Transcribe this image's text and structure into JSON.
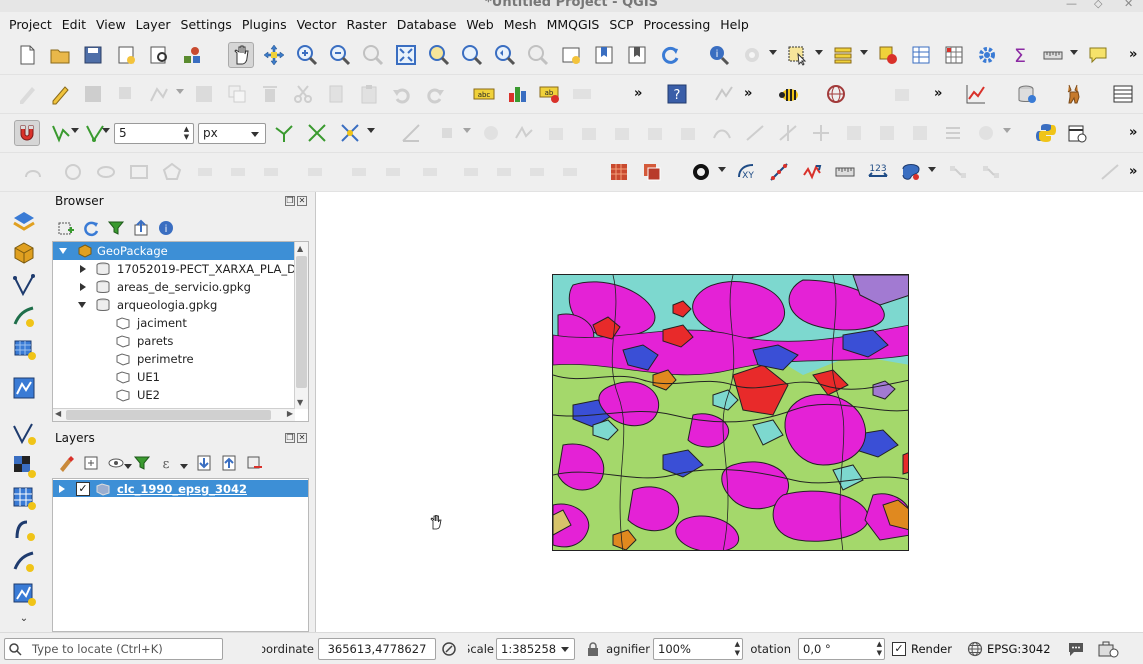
{
  "window": {
    "title": "*Untitled Project - QGIS"
  },
  "menu": [
    "Project",
    "Edit",
    "View",
    "Layer",
    "Settings",
    "Plugins",
    "Vector",
    "Raster",
    "Database",
    "Web",
    "Mesh",
    "MMQGIS",
    "SCP",
    "Processing",
    "Help"
  ],
  "snapping": {
    "tolerance": "5",
    "units": "px"
  },
  "browser": {
    "title": "Browser",
    "items": [
      {
        "label": "GeoPackage",
        "level": 0,
        "expanded": true,
        "selected": true,
        "icon": "geopackage-icon"
      },
      {
        "label": "17052019-PECT_XARXA_PLA_DE",
        "level": 1,
        "expanded": false,
        "icon": "database-icon"
      },
      {
        "label": "areas_de_servicio.gpkg",
        "level": 1,
        "expanded": false,
        "icon": "database-icon"
      },
      {
        "label": "arqueologia.gpkg",
        "level": 1,
        "expanded": true,
        "icon": "database-icon"
      },
      {
        "label": "jaciment",
        "level": 2,
        "icon": "polygon-layer-icon"
      },
      {
        "label": "parets",
        "level": 2,
        "icon": "polygon-layer-icon"
      },
      {
        "label": "perimetre",
        "level": 2,
        "icon": "polygon-layer-icon"
      },
      {
        "label": "UE1",
        "level": 2,
        "icon": "polygon-layer-icon"
      },
      {
        "label": "UE2",
        "level": 2,
        "icon": "polygon-layer-icon"
      }
    ]
  },
  "layers": {
    "title": "Layers",
    "items": [
      {
        "label": "clc_1990_epsg_3042",
        "checked": true,
        "selected": true
      }
    ]
  },
  "status": {
    "locator_placeholder": "Type to locate (Ctrl+K)",
    "coordinate_label": "Coordinate",
    "coordinate": "365613,4778627",
    "scale_label": "Scale",
    "scale": "1:385258",
    "magnifier_label": "Magnifier",
    "magnifier": "100%",
    "rotation_label": "Rotation",
    "rotation": "0,0 °",
    "render_label": "Render",
    "render_checked": true,
    "crs": "EPSG:3042"
  }
}
